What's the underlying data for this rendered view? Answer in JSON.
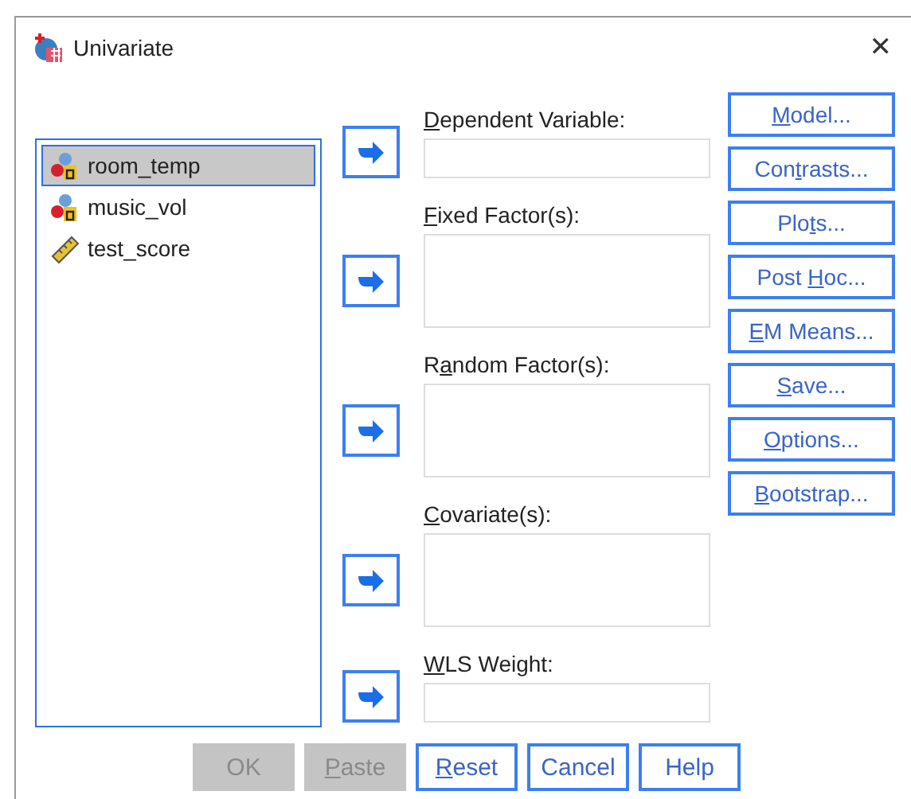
{
  "window": {
    "title": "Univariate",
    "close": "✕"
  },
  "variables": [
    {
      "name": "room_temp",
      "kind": "nominal",
      "selected": true
    },
    {
      "name": "music_vol",
      "kind": "nominal",
      "selected": false
    },
    {
      "name": "test_score",
      "kind": "scale",
      "selected": false
    }
  ],
  "targets": [
    {
      "label": {
        "key": "D",
        "after": "ependent Variable:"
      },
      "kind": "single"
    },
    {
      "label": {
        "key": "F",
        "after": "ixed Factor(s):"
      },
      "kind": "list"
    },
    {
      "label": {
        "before": "R",
        "key": "a",
        "after": "ndom Factor(s):"
      },
      "kind": "list"
    },
    {
      "label": {
        "key": "C",
        "after": "ovariate(s):"
      },
      "kind": "list"
    },
    {
      "label": {
        "key": "W",
        "after": "LS Weight:"
      },
      "kind": "single"
    }
  ],
  "side_buttons": [
    {
      "label": {
        "key": "M",
        "after": "odel..."
      }
    },
    {
      "label": {
        "before": "Con",
        "key": "t",
        "after": "rasts..."
      }
    },
    {
      "label": {
        "before": "Plo",
        "key": "t",
        "after": "s..."
      }
    },
    {
      "label": {
        "before": "Post ",
        "key": "H",
        "after": "oc..."
      }
    },
    {
      "label": {
        "key": "E",
        "after": "M Means..."
      }
    },
    {
      "label": {
        "key": "S",
        "after": "ave..."
      }
    },
    {
      "label": {
        "key": "O",
        "after": "ptions..."
      }
    },
    {
      "label": {
        "key": "B",
        "after": "ootstrap..."
      }
    }
  ],
  "bottom_buttons": [
    {
      "label": {
        "before": "OK"
      },
      "disabled": true
    },
    {
      "label": {
        "key": "P",
        "after": "aste"
      },
      "disabled": true
    },
    {
      "label": {
        "key": "R",
        "after": "eset"
      },
      "disabled": false
    },
    {
      "label": {
        "before": "Cancel"
      },
      "disabled": false
    },
    {
      "label": {
        "before": "Help"
      },
      "disabled": false
    }
  ]
}
